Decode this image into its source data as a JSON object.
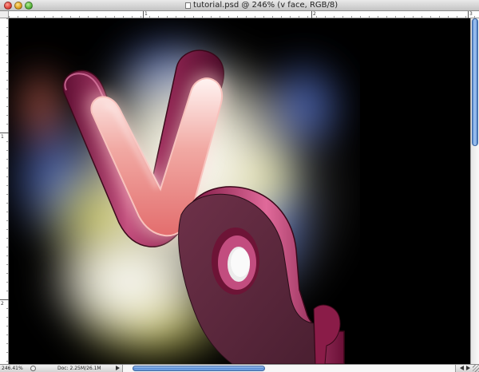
{
  "window": {
    "title": "tutorial.psd @ 246% (v face, RGB/8)",
    "buttons": [
      "close",
      "minimize",
      "zoom"
    ]
  },
  "rulers": {
    "top_labels": [
      "1",
      "2",
      "3"
    ],
    "left_labels": [
      "1",
      "2"
    ]
  },
  "canvas": {
    "description_colors": {
      "background": "#000000",
      "letter_main": "#8e1f4f",
      "letter_face": "#e47a7a",
      "glow_yellow": "#e8e36a",
      "glow_blue": "#5b7ad8"
    }
  },
  "status": {
    "zoom": "246.41%",
    "doc_info": "Doc: 2.25M/26.1M"
  },
  "icons": {
    "document": "document-icon",
    "status": "status-menu-icon",
    "scroll_left": "arrow-left-icon",
    "scroll_right": "arrow-right-icon"
  }
}
